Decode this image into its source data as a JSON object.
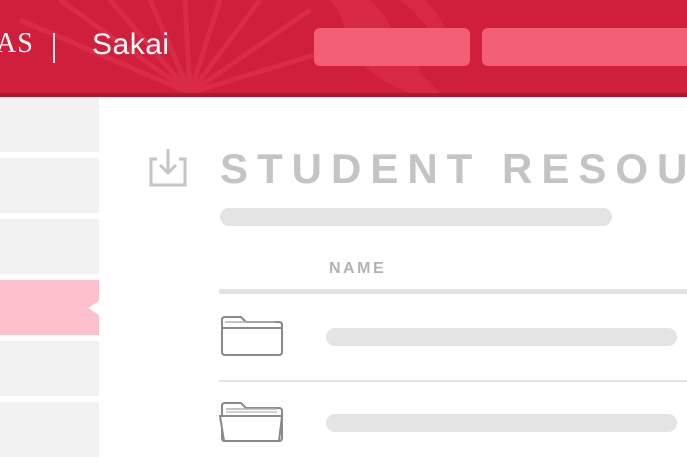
{
  "header": {
    "brand_fragment": "AS",
    "app_name": "Sakai",
    "background_color": "#d01f3c",
    "nav_buttons": [
      {
        "label": ""
      },
      {
        "label": ""
      }
    ],
    "accent_color": "#f25e74"
  },
  "sidebar": {
    "items": [
      {
        "label": "",
        "active": false
      },
      {
        "label": "",
        "active": false
      },
      {
        "label": "",
        "active": false
      },
      {
        "label": "",
        "active": true
      },
      {
        "label": "",
        "active": false
      },
      {
        "label": "",
        "active": false
      }
    ],
    "active_color": "#ffc0cd"
  },
  "main": {
    "title_icon": "download-icon",
    "title": "STUDENT RESOU",
    "table": {
      "columns": [
        "NAME"
      ],
      "rows": [
        {
          "icon": "folder-icon",
          "name": ""
        },
        {
          "icon": "folder-open-icon",
          "name": ""
        }
      ]
    }
  }
}
